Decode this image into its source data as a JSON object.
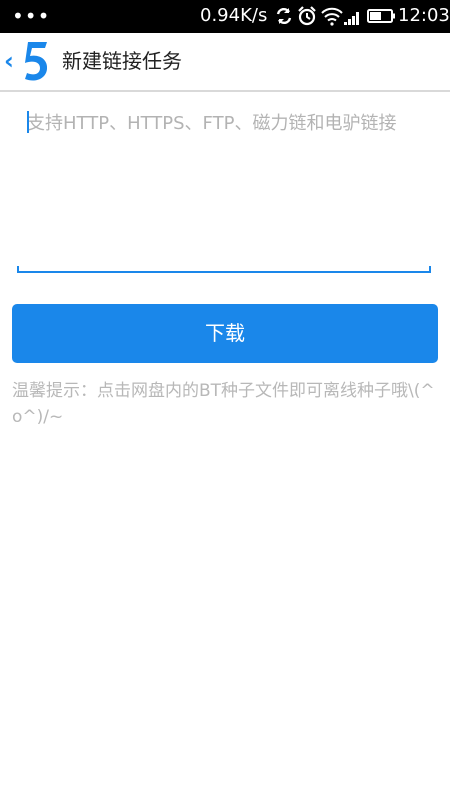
{
  "status_bar": {
    "dots": "•••",
    "network_speed": "0.94K/s",
    "time": "12:03",
    "icons": [
      "sync-icon",
      "alarm-icon",
      "wifi-icon",
      "signal-icon",
      "battery-icon"
    ]
  },
  "header": {
    "back_glyph": "‹",
    "logo_glyph": "5",
    "title": "新建链接任务"
  },
  "input": {
    "placeholder": "支持HTTP、HTTPS、FTP、磁力链和电驴链接",
    "value": ""
  },
  "download_button": {
    "label": "下载"
  },
  "tip": {
    "text": "温馨提示：点击网盘内的BT种子文件即可离线种子哦\\(^o^)/~"
  },
  "colors": {
    "accent": "#1a87ea",
    "status_bar": "#000000",
    "placeholder": "#b3b3b3",
    "tip": "#b8b8b8"
  }
}
